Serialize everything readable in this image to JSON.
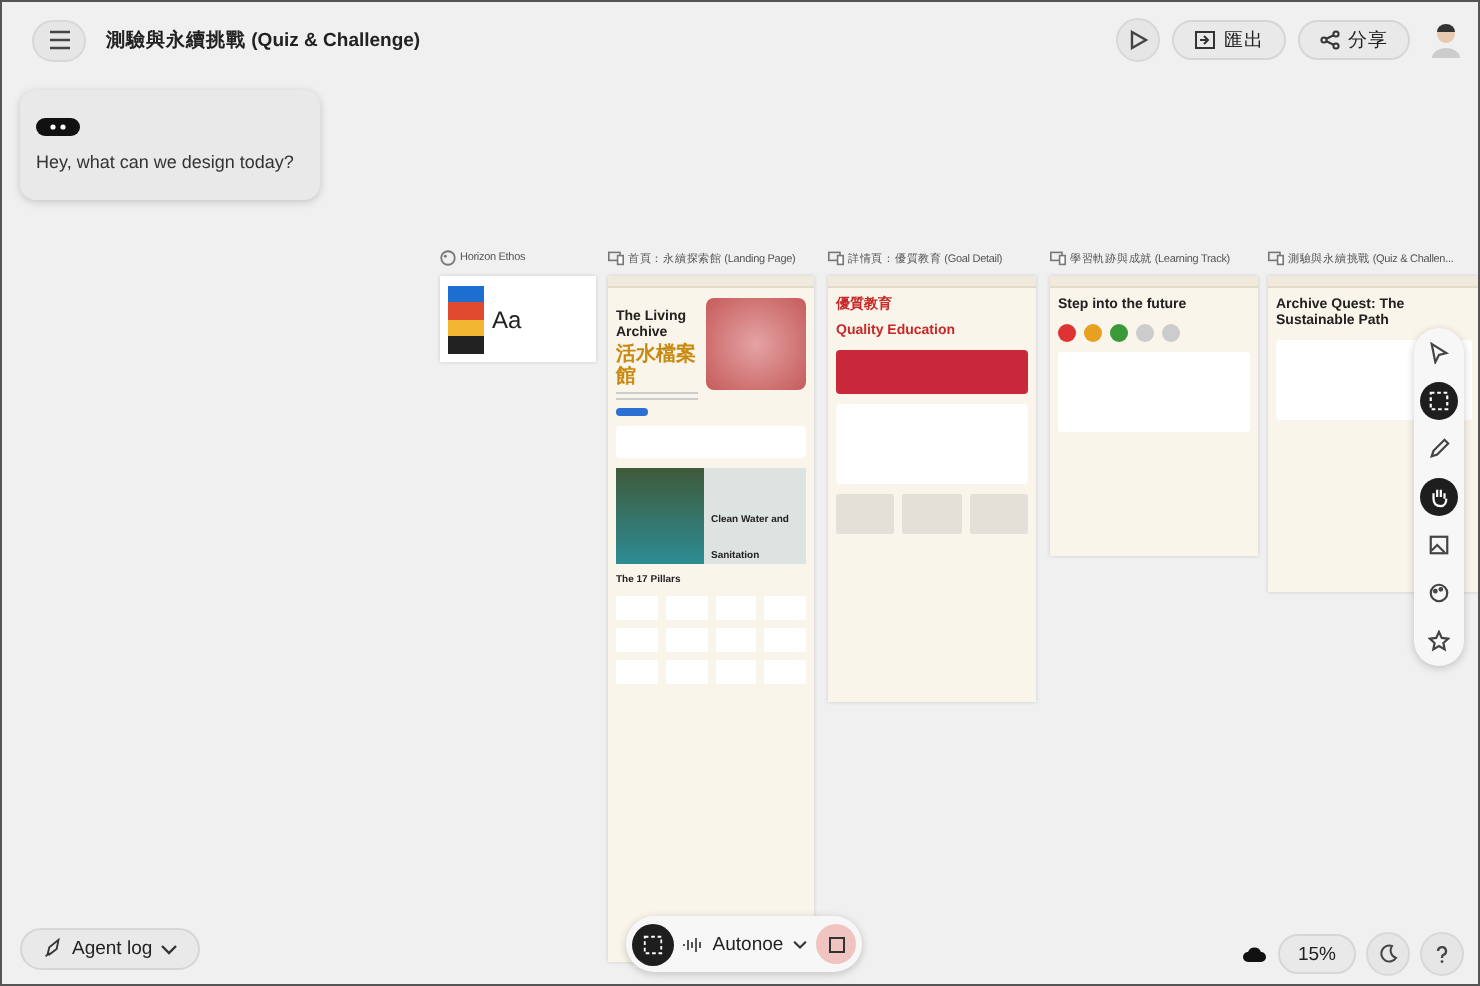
{
  "header": {
    "title": "測驗與永續挑戰 (Quiz & Challenge)",
    "export_label": "匯出",
    "share_label": "分享"
  },
  "chat": {
    "prompt": "Hey, what can we design today?"
  },
  "frames": [
    {
      "kind": "palette",
      "label": "Horizon Ethos",
      "swatch_text": "Aa"
    },
    {
      "kind": "landing",
      "label": "首頁：永續探索館 (Landing Page)",
      "heading": "The Living Archive",
      "subheading": "活水檔案館",
      "card_title": "Clean Water and Sanitation",
      "section_title": "The 17 Pillars"
    },
    {
      "kind": "detail",
      "label": "詳情頁：優質教育 (Goal Detail)",
      "heading": "優質教育",
      "subheading": "Quality Education"
    },
    {
      "kind": "track",
      "label": "學習軌跡與成就 (Learning Track)",
      "heading": "Step into the future"
    },
    {
      "kind": "quiz",
      "label": "測驗與永續挑戰 (Quiz & Challen...",
      "heading": "Archive Quest: The Sustainable Path"
    }
  ],
  "bottom_bar": {
    "voice_name": "Autonoe"
  },
  "agent_log": {
    "label": "Agent log"
  },
  "zoom": {
    "value": "15%"
  },
  "tools": [
    {
      "kind": "pointer",
      "selected": false
    },
    {
      "kind": "select",
      "selected": true
    },
    {
      "kind": "pencil",
      "selected": false
    },
    {
      "kind": "hand",
      "selected": true
    },
    {
      "kind": "image",
      "selected": false
    },
    {
      "kind": "palette",
      "selected": false
    },
    {
      "kind": "star",
      "selected": false
    }
  ]
}
